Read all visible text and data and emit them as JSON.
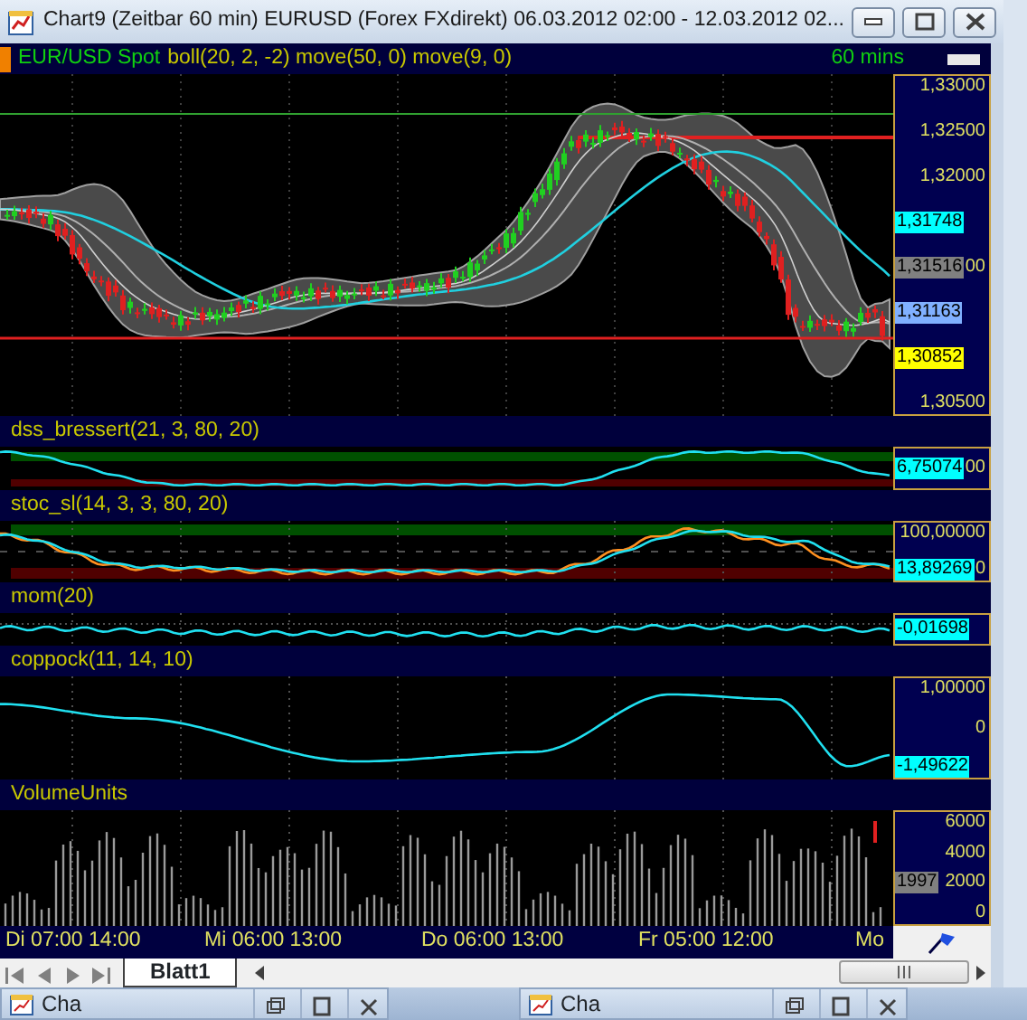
{
  "window": {
    "title": "Chart9 (Zeitbar 60 min)  EURUSD (Forex FXdirekt) 06.03.2012 02:00 - 12.03.2012 02..."
  },
  "price_panel": {
    "symbol": "EUR/USD Spot",
    "indicators": "boll(20, 2, -2) move(50, 0) move(9, 0)",
    "timeframe": "60 mins",
    "axis": [
      {
        "kind": "label",
        "text": "1,33000"
      },
      {
        "kind": "label",
        "text": "1,32500"
      },
      {
        "kind": "label",
        "text": "1,32000"
      },
      {
        "kind": "tag",
        "text": "1,31748",
        "color": "#00ffff"
      },
      {
        "kind": "tag",
        "text": "1,31516",
        "color": "#808080",
        "tail": "00"
      },
      {
        "kind": "tag",
        "text": "1,31163",
        "color": "#80b0ff"
      },
      {
        "kind": "tag",
        "text": "1,30852",
        "color": "#ffff00"
      },
      {
        "kind": "label",
        "text": "1,30500"
      }
    ]
  },
  "indicator_panels": [
    {
      "title": "dss_bressert(21, 3, 80, 20)",
      "kind": "oscillator",
      "axis": [
        {
          "kind": "tag",
          "text": "6,75074",
          "color": "#00ffff",
          "tail": "00"
        }
      ]
    },
    {
      "title": "stoc_sl(14, 3, 3, 80, 20)",
      "kind": "stochastic",
      "axis": [
        {
          "kind": "label",
          "text": "100,00000"
        },
        {
          "kind": "tag",
          "text": "13,89269",
          "color": "#00ffff",
          "tail": "0"
        }
      ]
    },
    {
      "title": "mom(20)",
      "kind": "momentum",
      "axis": [
        {
          "kind": "tag",
          "text": "-0,01698",
          "color": "#00ffff"
        }
      ]
    },
    {
      "title": "coppock(11, 14, 10)",
      "kind": "curve",
      "axis": [
        {
          "kind": "label",
          "text": "1,00000"
        },
        {
          "kind": "label",
          "text": "0"
        },
        {
          "kind": "tag",
          "text": "-1,49622",
          "color": "#00ffff"
        }
      ]
    },
    {
      "title": "VolumeUnits",
      "kind": "volume",
      "axis": [
        {
          "kind": "label",
          "text": "6000"
        },
        {
          "kind": "label",
          "text": "4000"
        },
        {
          "kind": "tag",
          "text": "1997",
          "color": "#808080",
          "tail": "2000"
        },
        {
          "kind": "label",
          "text": "0"
        }
      ]
    }
  ],
  "time_axis": [
    "Di  07:00  14:00",
    "Mi  06:00  13:00",
    "Do  06:00  13:00",
    "Fr  05:00  12:00",
    "Mo"
  ],
  "sheet_tabs": [
    {
      "label": "Blatt1",
      "selected": true
    }
  ],
  "taskbar": [
    {
      "label": "Cha"
    },
    {
      "label": "Cha"
    }
  ]
}
